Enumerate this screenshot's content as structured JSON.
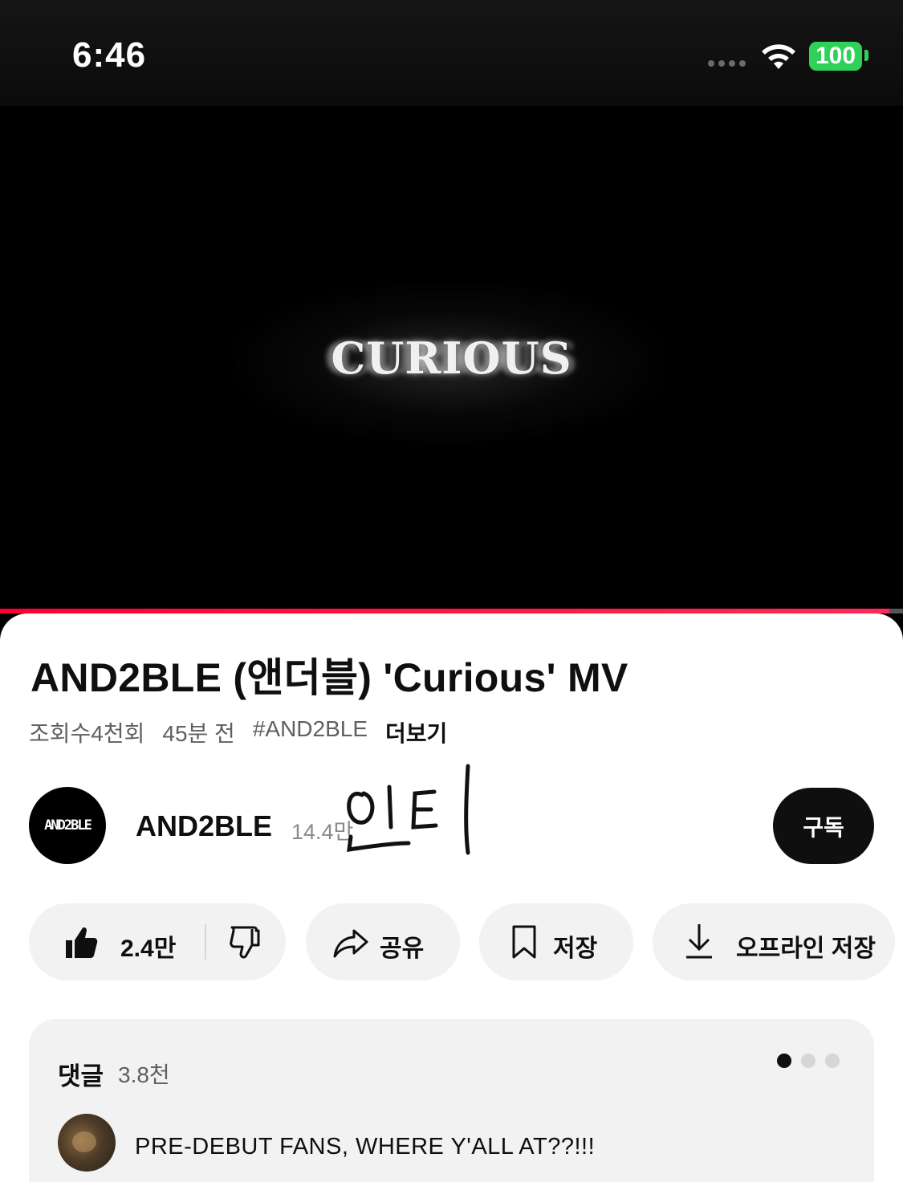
{
  "status_bar": {
    "time": "6:46",
    "battery": "100"
  },
  "video": {
    "overlay_text": "CURIOUS",
    "progress_fraction": 0.985
  },
  "video_info": {
    "title": "AND2BLE (앤더블) 'Curious' MV",
    "views": "조회수4천회",
    "age": "45분 전",
    "hashtag": "#AND2BLE",
    "more_label": "더보기"
  },
  "channel": {
    "avatar_text": "AND2BLE",
    "name": "AND2BLE",
    "subscribers": "14.4만",
    "subscribe_label": "구독",
    "handwriting": "인티"
  },
  "actions": {
    "like_count": "2.4만",
    "share_label": "공유",
    "save_label": "저장",
    "offline_label": "오프라인 저장"
  },
  "comments": {
    "title": "댓글",
    "count": "3.8천",
    "pages": 3,
    "active_page": 1,
    "top_comment": "PRE-DEBUT FANS, WHERE Y'ALL AT??!!!"
  }
}
